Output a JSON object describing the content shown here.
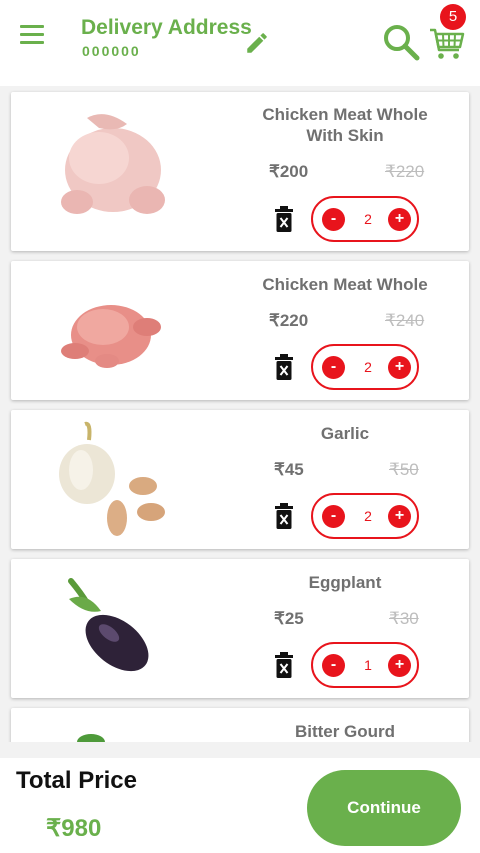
{
  "header": {
    "title": "Delivery Address",
    "pincode": "000000",
    "cart_count": "5"
  },
  "colors": {
    "brand_green": "#6ab04c",
    "accent_red": "#e8141c"
  },
  "icons": {
    "menu": "menu-icon",
    "edit": "edit-icon",
    "search": "search-icon",
    "cart": "cart-icon",
    "delete": "trash-icon"
  },
  "items": [
    {
      "name": "Chicken Meat Whole With Skin",
      "price": "₹200",
      "mrp": "₹220",
      "qty": "2"
    },
    {
      "name": "Chicken Meat Whole",
      "price": "₹220",
      "mrp": "₹240",
      "qty": "2"
    },
    {
      "name": "Garlic",
      "price": "₹45",
      "mrp": "₹50",
      "qty": "2"
    },
    {
      "name": "Eggplant",
      "price": "₹25",
      "mrp": "₹30",
      "qty": "1"
    },
    {
      "name": "Bitter Gourd"
    }
  ],
  "stepper": {
    "minus": "-",
    "plus": "+"
  },
  "footer": {
    "total_label": "Total Price",
    "total_value": "₹980",
    "continue_label": "Continue"
  }
}
